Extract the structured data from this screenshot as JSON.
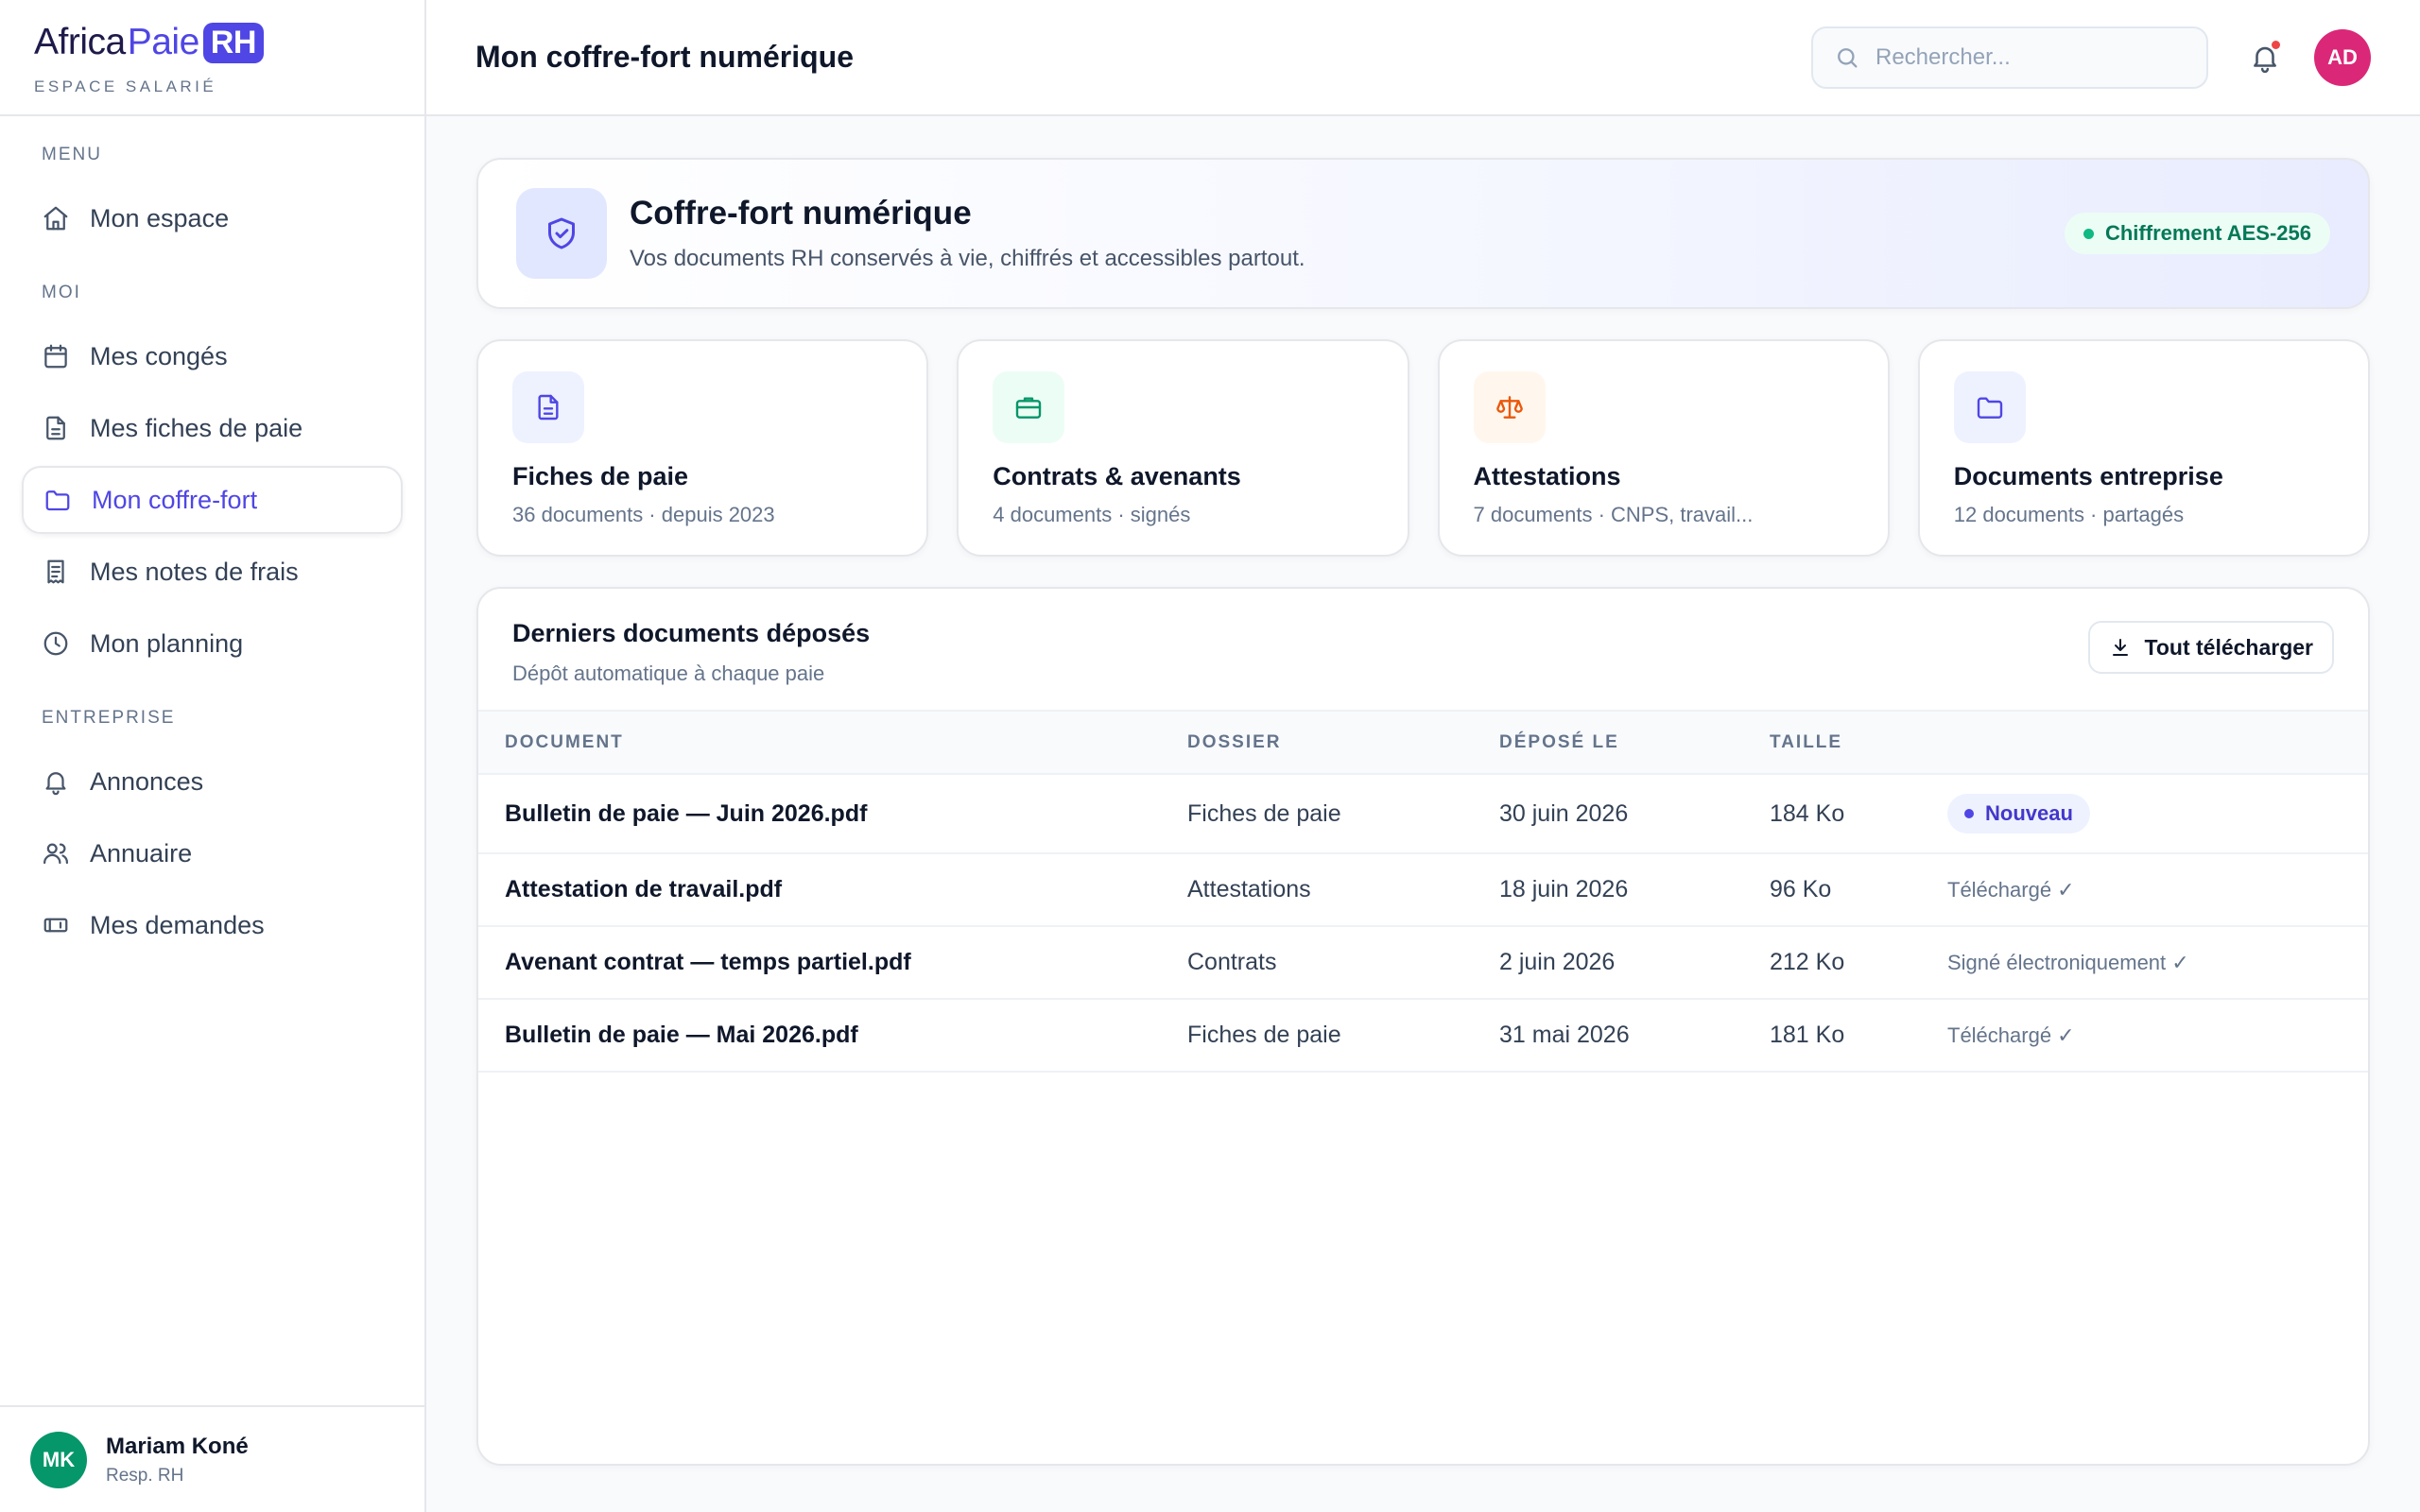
{
  "brand": {
    "africa": "Africa",
    "paie": "Paie",
    "rh": "RH",
    "subtitle": "ESPACE SALARIÉ"
  },
  "nav": {
    "sections": [
      "MENU",
      "MOI",
      "ENTREPRISE"
    ],
    "items": [
      {
        "label": "Mon espace",
        "icon": "home-icon"
      },
      {
        "label": "Mes congés",
        "icon": "calendar-icon"
      },
      {
        "label": "Mes fiches de paie",
        "icon": "document-icon"
      },
      {
        "label": "Mon coffre-fort",
        "icon": "folder-icon",
        "active": true
      },
      {
        "label": "Mes notes de frais",
        "icon": "receipt-icon"
      },
      {
        "label": "Mon planning",
        "icon": "clock-icon"
      },
      {
        "label": "Annonces",
        "icon": "bell-icon"
      },
      {
        "label": "Annuaire",
        "icon": "users-icon"
      },
      {
        "label": "Mes demandes",
        "icon": "ticket-icon"
      }
    ]
  },
  "user": {
    "initials": "MK",
    "name": "Mariam Koné",
    "role": "Resp. RH",
    "color": "#059669"
  },
  "topbar": {
    "title": "Mon coffre-fort numérique",
    "search_placeholder": "Rechercher...",
    "avatar_initials": "AD",
    "avatar_color": "#db2777"
  },
  "hero": {
    "title": "Coffre-fort numérique",
    "subtitle": "Vos documents RH conservés à vie, chiffrés et accessibles partout.",
    "badge": "Chiffrement AES-256"
  },
  "cards": [
    {
      "title": "Fiches de paie",
      "sub": "36 documents · depuis 2023",
      "icon": "file-text-icon",
      "bg": "#eef2ff",
      "color": "#4f46e5"
    },
    {
      "title": "Contrats & avenants",
      "sub": "4 documents · signés",
      "icon": "briefcase-icon",
      "bg": "#ecfdf5",
      "color": "#059669"
    },
    {
      "title": "Attestations",
      "sub": "7 documents · CNPS, travail...",
      "icon": "scale-icon",
      "bg": "#fff7ed",
      "color": "#ea580c"
    },
    {
      "title": "Documents entreprise",
      "sub": "12 documents · partagés",
      "icon": "folder-icon",
      "bg": "#eef2ff",
      "color": "#4f46e5"
    }
  ],
  "panel": {
    "title": "Derniers documents déposés",
    "subtitle": "Dépôt automatique à chaque paie",
    "download_label": "Tout télécharger",
    "columns": [
      "DOCUMENT",
      "DOSSIER",
      "DÉPOSÉ LE",
      "TAILLE",
      ""
    ],
    "rows": [
      {
        "doc": "Bulletin de paie — Juin 2026.pdf",
        "folder": "Fiches de paie",
        "date": "30 juin 2026",
        "size": "184 Ko",
        "status": "Nouveau",
        "is_new": true
      },
      {
        "doc": "Attestation de travail.pdf",
        "folder": "Attestations",
        "date": "18 juin 2026",
        "size": "96 Ko",
        "status": "Téléchargé ✓",
        "is_new": false
      },
      {
        "doc": "Avenant contrat — temps partiel.pdf",
        "folder": "Contrats",
        "date": "2 juin 2026",
        "size": "212 Ko",
        "status": "Signé électroniquement ✓",
        "is_new": false
      },
      {
        "doc": "Bulletin de paie — Mai 2026.pdf",
        "folder": "Fiches de paie",
        "date": "31 mai 2026",
        "size": "181 Ko",
        "status": "Téléchargé ✓",
        "is_new": false
      }
    ]
  },
  "colors": {
    "accent": "#4f46e5",
    "border": "#e5e7eb",
    "success": "#10b981"
  }
}
